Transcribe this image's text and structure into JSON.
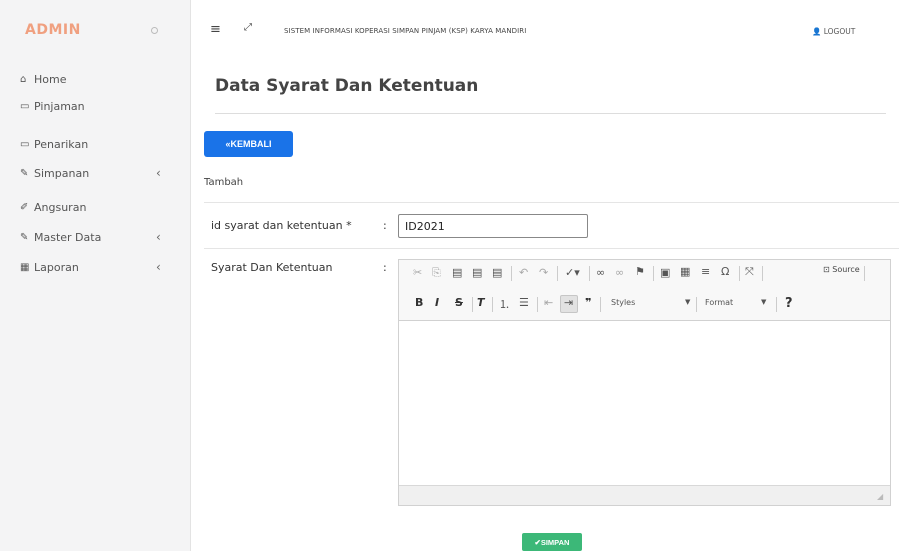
{
  "sidebar": {
    "brand": "ADMIN",
    "items": [
      {
        "label": "Home",
        "icon": "home-icon",
        "glyph": "⌂"
      },
      {
        "label": "Pinjaman",
        "icon": "credit-card-icon",
        "glyph": "▭"
      },
      {
        "label": "Penarikan",
        "icon": "credit-card-icon",
        "glyph": "▭"
      },
      {
        "label": "Simpanan",
        "icon": "edit-icon",
        "glyph": "✎",
        "chevron": "‹"
      },
      {
        "label": "Angsuran",
        "icon": "pencil-icon",
        "glyph": "✐"
      },
      {
        "label": "Master Data",
        "icon": "edit-icon",
        "glyph": "✎",
        "chevron": "‹"
      },
      {
        "label": "Laporan",
        "icon": "calendar-icon",
        "glyph": "▦",
        "chevron": "‹"
      }
    ]
  },
  "topbar": {
    "title": "SISTEM INFORMASI KOPERASI SIMPAN PINJAM (KSP) KARYA MANDIRI",
    "logout": "LOGOUT"
  },
  "page": {
    "title": "Data Syarat Dan Ketentuan",
    "back_button": "KEMBALI",
    "subtitle": "Tambah"
  },
  "form": {
    "id_label": "id syarat dan ketentuan *",
    "id_value": "ID2021",
    "terms_label": "Syarat Dan Ketentuan",
    "colon": ":"
  },
  "editor": {
    "source_label": "Source",
    "styles_label": "Styles",
    "format_label": "Format",
    "help_label": "?"
  },
  "actions": {
    "save_button": "SIMPAN"
  },
  "colors": {
    "brand": "#f0a080",
    "primary": "#1a73e8",
    "success": "#3cb878"
  }
}
